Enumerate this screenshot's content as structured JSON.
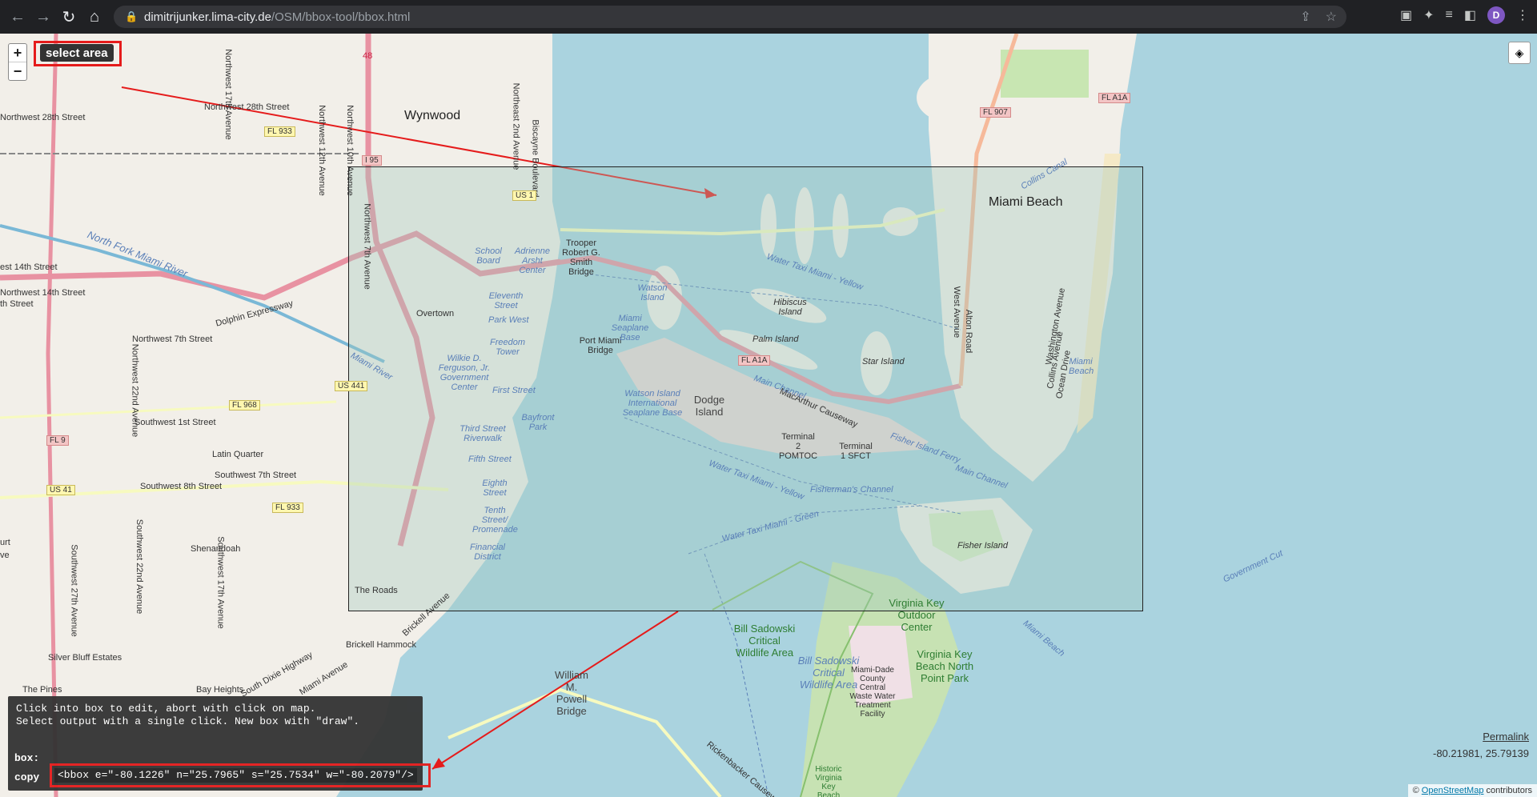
{
  "browser": {
    "url_host": "dimitrijunker.lima-city.de",
    "url_path": "/OSM/bbox-tool/bbox.html",
    "avatar_letter": "D"
  },
  "map_controls": {
    "zoom_in": "+",
    "zoom_out": "−",
    "select_area_label": "select area"
  },
  "map_labels": {
    "wynwood": "Wynwood",
    "miami_beach": "Miami Beach",
    "north_fork": "North Fork Miami River",
    "dolphin": "Dolphin Expressway",
    "nw28": "Northwest 28th Street",
    "nw28b": "Northwest 28th Street",
    "nw14": "est 14th Street",
    "nw7": "Northwest 7th Street",
    "sw1": "Southwest 1st Street",
    "sw7": "Southwest 7th Street",
    "sw8": "Southwest 8th Street",
    "latin_quarter": "Latin Quarter",
    "shenandoah": "Shenandoah",
    "silver_bluff": "Silver Bluff Estates",
    "the_pines": "The Pines",
    "bay_heights": "Bay Heights",
    "the_roads": "The Roads",
    "brickell_hammock": "Brickell Hammock",
    "school_board": "School Board",
    "adrienne": "Adrienne Arsht Center",
    "trooper": "Trooper Robert G. Smith Bridge",
    "eleventh": "Eleventh Street",
    "park_west": "Park West",
    "freedom": "Freedom Tower",
    "overtown": "Overtown",
    "port_miami_bridge": "Port Miami Bridge",
    "wilkie": "Wilkie D. Ferguson, Jr. Government Center",
    "first_street": "First Street",
    "bayfront": "Bayfront Park",
    "third_street": "Third Street Riverwalk",
    "fifth_street": "Fifth Street",
    "eighth_street": "Eighth Street",
    "tenth_street": "Tenth Street/ Promenade",
    "financial": "Financial District",
    "miami_river": "Miami River",
    "watson_island": "Watson Island",
    "seaplane": "Miami Seaplane Base",
    "watson_intl": "Watson Island International Seaplane Base",
    "dodge": "Dodge Island",
    "terminal2": "Terminal 2 POMTOC",
    "terminal1": "Terminal 1 SFCT",
    "hibiscus": "Hibiscus Island",
    "palm": "Palm Island",
    "star": "Star Island",
    "macarthur": "MacArthur Causeway",
    "water_taxi_yellow": "Water Taxi Miami - Yellow",
    "water_taxi_yellow2": "Water Taxi Miami - Yellow",
    "water_taxi_green": "Water Taxi Miami - Green",
    "main_channel": "Main Channel",
    "fishermans": "Fisherman's Channel",
    "fisher_ferry": "Fisher Island Ferry",
    "main_channel2": "Main Channel",
    "fisher_island": "Fisher Island",
    "bill_sadowski": "Bill Sadowski Critical Wildlife Area",
    "bill_sadowski2": "Bill Sadowski Critical Wildlife Area",
    "virginia_key_outdoor": "Virginia Key Outdoor Center",
    "miami_dade_plant": "Miami-Dade County Central Waste Water Treatment Facility",
    "virginia_key_beach": "Virginia Key Beach North Point Park",
    "historic_virginia": "Historic Virginia Key Beach",
    "william_powell": "William M. Powell Bridge",
    "rickenbacker": "Rickenbacker Causeway",
    "south_dixie": "South Dixie Highway",
    "miami_avenue": "Miami Avenue",
    "brickell_avenue": "Brickell Avenue",
    "government_cut": "Government Cut",
    "miami_beach_channel": "Miami Beach",
    "miami_beach_small": "Miami Beach",
    "alton": "Alton Road",
    "west_ave": "West Avenue",
    "washington": "Washington Avenue",
    "collins": "Collins Avenue",
    "ocean": "Ocean Drive",
    "collins_canal": "Collins Canal",
    "nw27": "Southwest 27th Avenue",
    "nw22": "Northwest 22nd Avenue",
    "sw22": "Southwest 22nd Avenue",
    "sw17": "Southwest 17th Avenue",
    "nw17": "Northwest 17th Avenue",
    "nw12": "Northwest 12th Avenue",
    "nw10": "Northwest 10th Avenue",
    "nw7ave": "Northwest 7th Avenue",
    "ne2": "Northeast 2nd Avenue",
    "biscayne": "Biscayne Boulevard",
    "ne14": "Northwest 14th Street",
    "curt": "urt",
    "ave": "ve",
    "sw8b": "th Street"
  },
  "shields": {
    "i95": "I 95",
    "us1": "US 1",
    "us441": "US 441",
    "us41": "US 41",
    "fl968": "FL 968",
    "fl9": "FL 9",
    "fl933": "FL 933",
    "fl933b": "FL 933",
    "fla1a": "FL A1A",
    "fla1a2": "FL A1A",
    "fl907": "FL 907",
    "fl836": "48"
  },
  "panel": {
    "info_line1": "Click into box to edit, abort with click on map.",
    "info_line2": "Select output with a single click. New box with \"draw\".",
    "box_label": "box:",
    "copy_label": "copy",
    "output": "<bbox e=\"-80.1226\" n=\"25.7965\" s=\"25.7534\" w=\"-80.2079\"/>"
  },
  "footer": {
    "permalink": "Permalink",
    "coords": "-80.21981, 25.79139",
    "attrib_prefix": "©",
    "attrib_link": "OpenStreetMap",
    "attrib_suffix": "contributors"
  },
  "colors": {
    "water": "#aad3df",
    "land": "#f2efe9",
    "highlight_red": "#e51b1b"
  }
}
